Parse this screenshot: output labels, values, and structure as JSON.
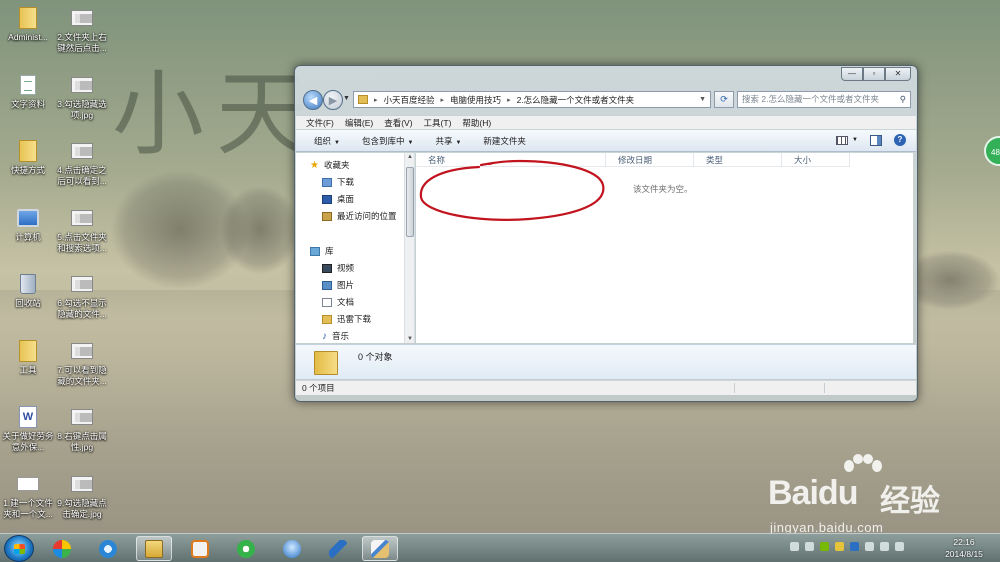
{
  "desktop": {
    "icons_left": [
      {
        "label": "Administ...",
        "icon": "folder-user-icon"
      },
      {
        "label": "文字资料",
        "icon": "document-icon"
      },
      {
        "label": "快捷方式",
        "icon": "shortcut-folder-icon"
      },
      {
        "label": "计算机",
        "icon": "computer-icon"
      },
      {
        "label": "回收站",
        "icon": "recycle-bin-icon"
      },
      {
        "label": "工具",
        "icon": "folder-icon"
      },
      {
        "label": "关于做好劳务意外保...",
        "icon": "word-doc-icon"
      },
      {
        "label": "1.建一个文件夹和一个文...",
        "icon": "image-icon"
      }
    ],
    "icons_right": [
      {
        "label": "2.文件夹上右键然后点击...",
        "icon": "image-icon"
      },
      {
        "label": "3.勾选隐藏选项.jpg",
        "icon": "image-icon"
      },
      {
        "label": "4.点击确定之后可以看到...",
        "icon": "image-icon"
      },
      {
        "label": "5.点击文件夹和搜索选项...",
        "icon": "image-icon"
      },
      {
        "label": "6.勾选不显示隐藏的文件...",
        "icon": "image-icon"
      },
      {
        "label": "7.可以看到隐藏的文件夹...",
        "icon": "image-icon"
      },
      {
        "label": "8.右键点击属性.jpg",
        "icon": "image-icon"
      },
      {
        "label": "9.勾选隐藏点击确定.jpg",
        "icon": "image-icon"
      }
    ],
    "side_badge": "48"
  },
  "window": {
    "controls": {
      "minimize": "—",
      "maximize": "▫",
      "close": "✕"
    },
    "address": {
      "crumbs": [
        "小天百度经验",
        "电脑使用技巧",
        "2.怎么隐藏一个文件或者文件夹"
      ],
      "separator": "▸"
    },
    "search": {
      "placeholder": "搜索 2.怎么隐藏一个文件或者文件夹"
    },
    "menu": [
      "文件(F)",
      "编辑(E)",
      "查看(V)",
      "工具(T)",
      "帮助(H)"
    ],
    "toolbar": {
      "organize": "组织",
      "include": "包含到库中",
      "share": "共享",
      "new_folder": "新建文件夹"
    },
    "nav": {
      "favorites_header": "收藏夹",
      "favorites": [
        "下载",
        "桌面",
        "最近访问的位置"
      ],
      "library_header": "库",
      "libraries": [
        "视频",
        "图片",
        "文档",
        "迅雷下载",
        "音乐"
      ]
    },
    "columns": [
      "名称",
      "修改日期",
      "类型",
      "大小"
    ],
    "empty_message": "该文件夹为空。",
    "details_count": "0 个对象",
    "status": "0 个项目"
  },
  "taskbar": {
    "apps": [
      "start",
      "360-icon",
      "ie-icon",
      "explorer-icon",
      "media-player-icon",
      "360-browser-icon",
      "qq-icon",
      "flying-bird-icon",
      "paint-icon"
    ],
    "time": "22:16",
    "date": "2014/8/15"
  },
  "watermark": {
    "brand_bai": "Bai",
    "brand_du": "du",
    "jingyan": "经验",
    "url": "jingyan.baidu.com"
  },
  "wallpaper_text": "小天",
  "colors": {
    "annotation_red": "#c2141e",
    "accent_blue": "#2d64b5"
  }
}
